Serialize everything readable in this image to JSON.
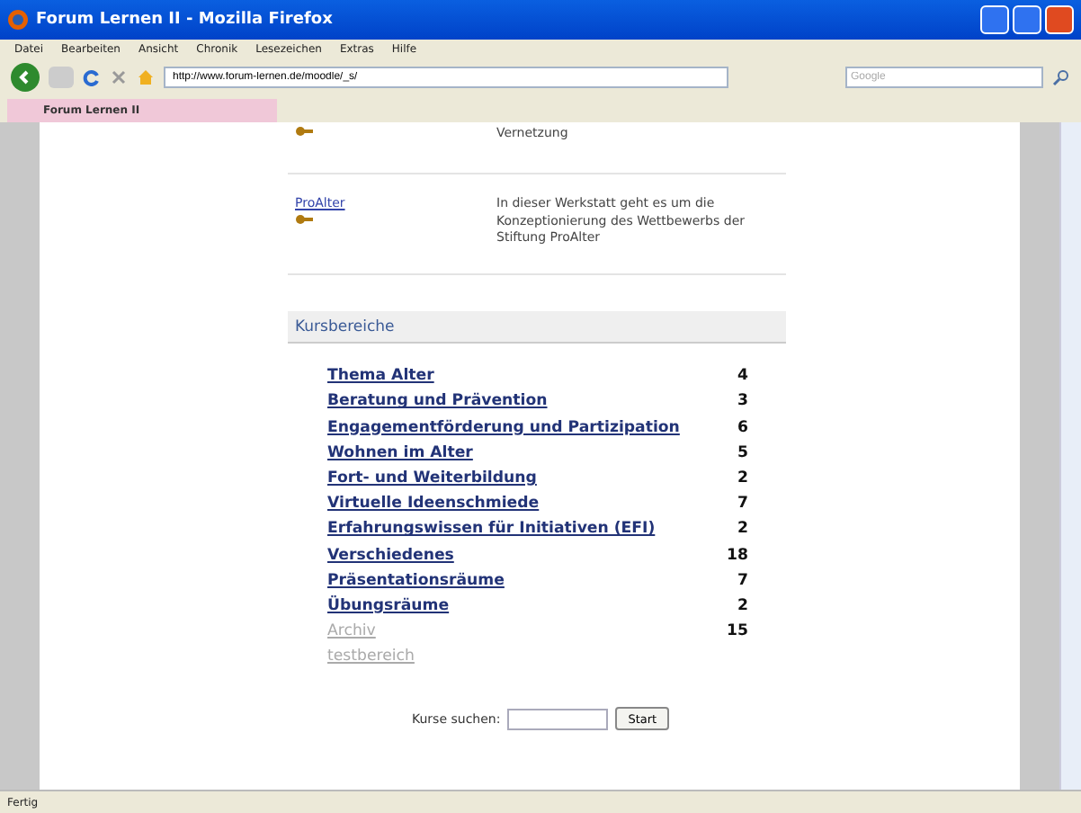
{
  "window": {
    "title": "Forum Lernen II - Mozilla Firefox"
  },
  "menu": [
    "Datei",
    "Bearbeiten",
    "Ansicht",
    "Chronik",
    "Lesezeichen",
    "Extras",
    "Hilfe"
  ],
  "address": {
    "value": "http://www.forum-lernen.de/moodle/_s/"
  },
  "search": {
    "placeholder": "Google"
  },
  "tabs": [
    {
      "label": "Forum Lernen II",
      "selected": true
    }
  ],
  "courses": [
    {
      "description": "Vernetzung"
    },
    {
      "name": "ProAlter",
      "description": "In dieser Werkstatt geht es um die Konzeptionierung des Wettbewerbs der Stiftung ProAlter"
    }
  ],
  "categories": {
    "title": "Kursbereiche",
    "items": [
      {
        "name": "Thema Alter",
        "count": "4",
        "hidden": false
      },
      {
        "name": "Beratung und Prävention",
        "count": "3",
        "hidden": false
      },
      {
        "name": "Engagementförderung und Partizipation",
        "count": "6",
        "hidden": false
      },
      {
        "name": "Wohnen im Alter",
        "count": "5",
        "hidden": false
      },
      {
        "name": "Fort- und Weiterbildung",
        "count": "2",
        "hidden": false
      },
      {
        "name": "Virtuelle Ideenschmiede",
        "count": "7",
        "hidden": false
      },
      {
        "name": "Erfahrungswissen für Initiativen (EFI)",
        "count": "2",
        "hidden": false
      },
      {
        "name": "Verschiedenes",
        "count": "18",
        "hidden": false
      },
      {
        "name": "Präsentationsräume",
        "count": "7",
        "hidden": false
      },
      {
        "name": "Übungsräume",
        "count": "2",
        "hidden": false
      },
      {
        "name": "Archiv",
        "count": "15",
        "hidden": true
      },
      {
        "name": "testbereich",
        "hidden": true
      }
    ]
  },
  "course_search": {
    "label": "Kurse suchen:",
    "button": "Start"
  },
  "status_bar": {
    "text": "Fertig"
  }
}
